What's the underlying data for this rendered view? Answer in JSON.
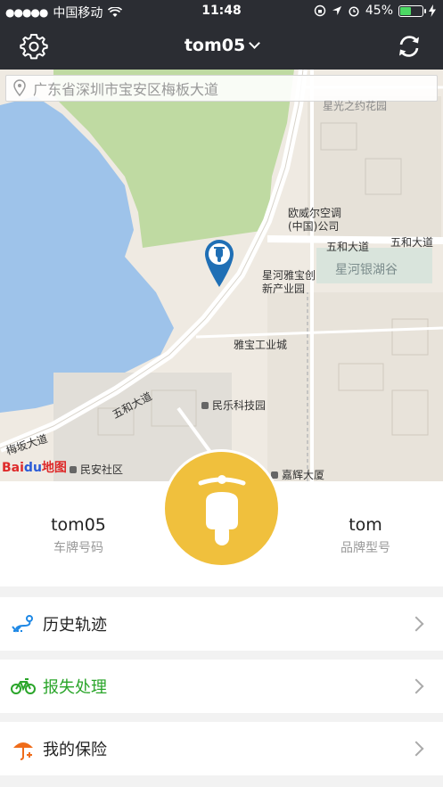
{
  "status_bar": {
    "signal_dots": "●●●●●",
    "carrier": "中国移动",
    "time": "11:48",
    "battery_percent": "45%",
    "battery_level": 0.45
  },
  "header": {
    "title": "tom05",
    "left_icon": "gear-icon",
    "right_icon": "refresh-icon"
  },
  "map": {
    "address": "广东省深圳市宝安区梅板大道",
    "labels": {
      "garden": "星光之约花园",
      "aux": "欧威尔空调\n(中国)公司",
      "road_wuhe_right": "五和大道",
      "xinghe_yinhu": "星河银湖谷",
      "xinghe_yabao": "星河雅宝创\n新产业园",
      "yabao_city": "雅宝工业城",
      "road_wuhe_left": "五和大道",
      "minle": "民乐科技园",
      "meiban": "梅坂大道",
      "minan": "民安社区",
      "jiahui": "嘉辉大厦"
    },
    "logo_text": "Bai",
    "logo_text_blue": "du",
    "logo_text_suffix": "地图"
  },
  "vehicle": {
    "plate": "tom05",
    "plate_label": "车牌号码",
    "brand": "tom",
    "brand_label": "品牌型号"
  },
  "menu": [
    {
      "label": "历史轨迹",
      "icon": "route-icon",
      "color": "#1e88e5"
    },
    {
      "label": "报失处理",
      "icon": "bicycle-icon",
      "color": "#2aa52a"
    },
    {
      "label": "我的保险",
      "icon": "umbrella-icon",
      "color": "#ef6c1a"
    }
  ]
}
